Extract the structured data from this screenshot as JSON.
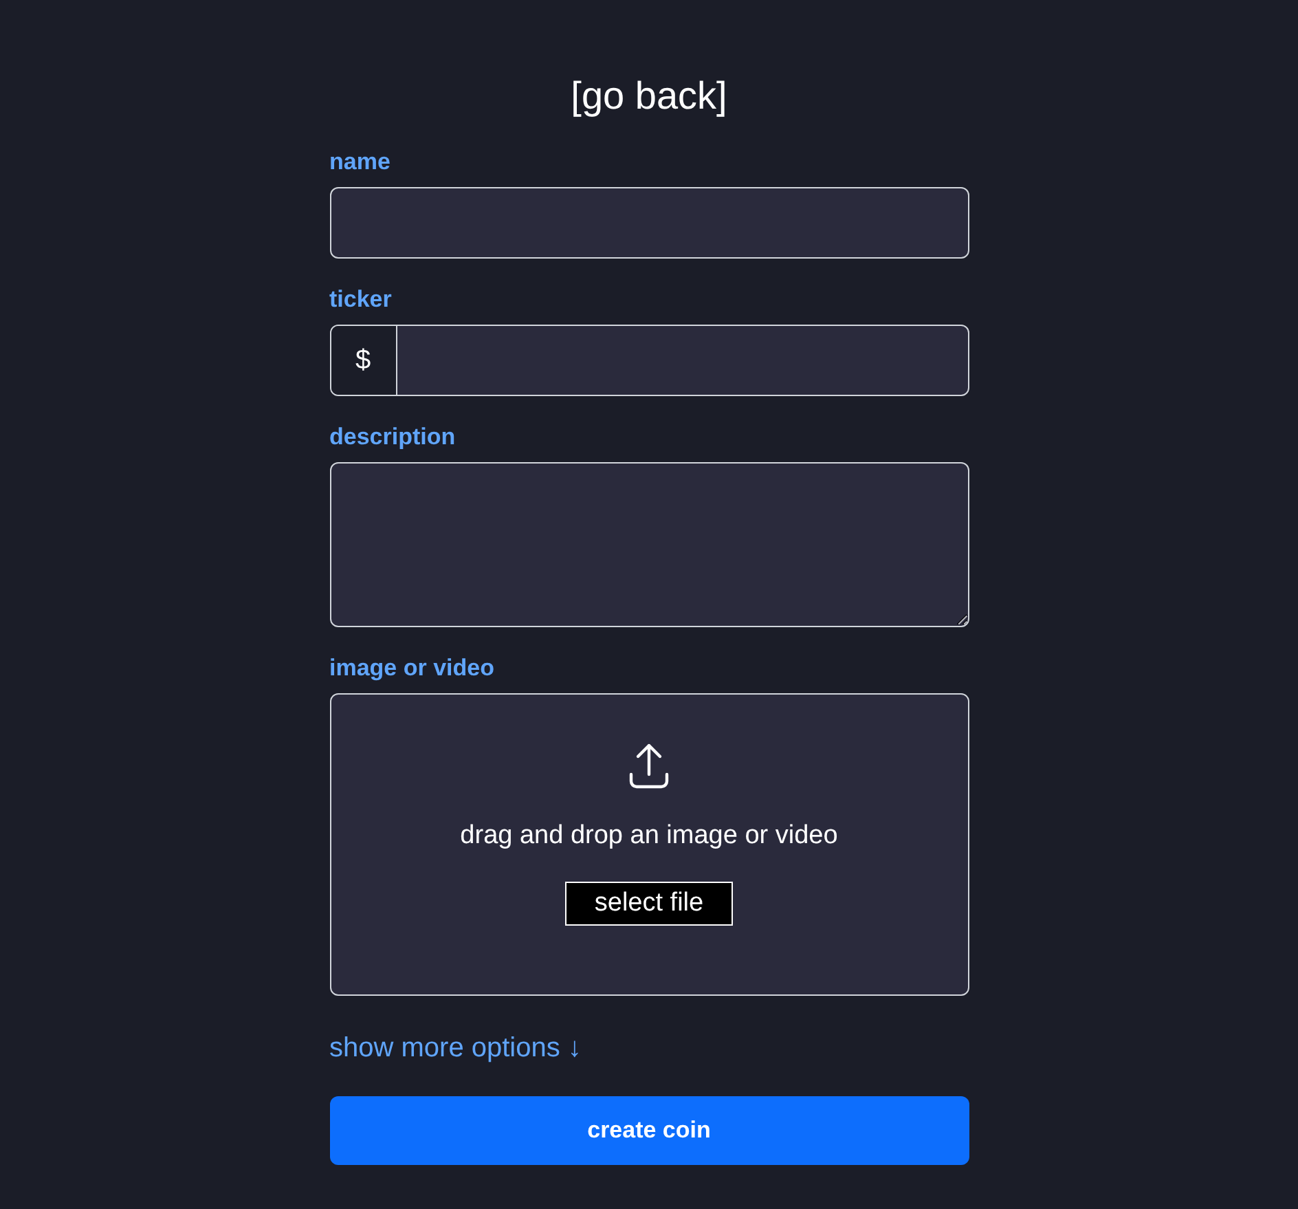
{
  "back_link": "[go back]",
  "fields": [
    {
      "kind": "text",
      "label": "name"
    },
    {
      "kind": "prefixed",
      "label": "ticker",
      "prefix": "$"
    },
    {
      "kind": "textarea",
      "label": "description"
    },
    {
      "kind": "upload",
      "label": "image or video",
      "hint": "drag and drop an image or video",
      "button": "select file"
    }
  ],
  "more_options": {
    "label": "show more options",
    "arrow": "↓"
  },
  "submit": "create coin"
}
